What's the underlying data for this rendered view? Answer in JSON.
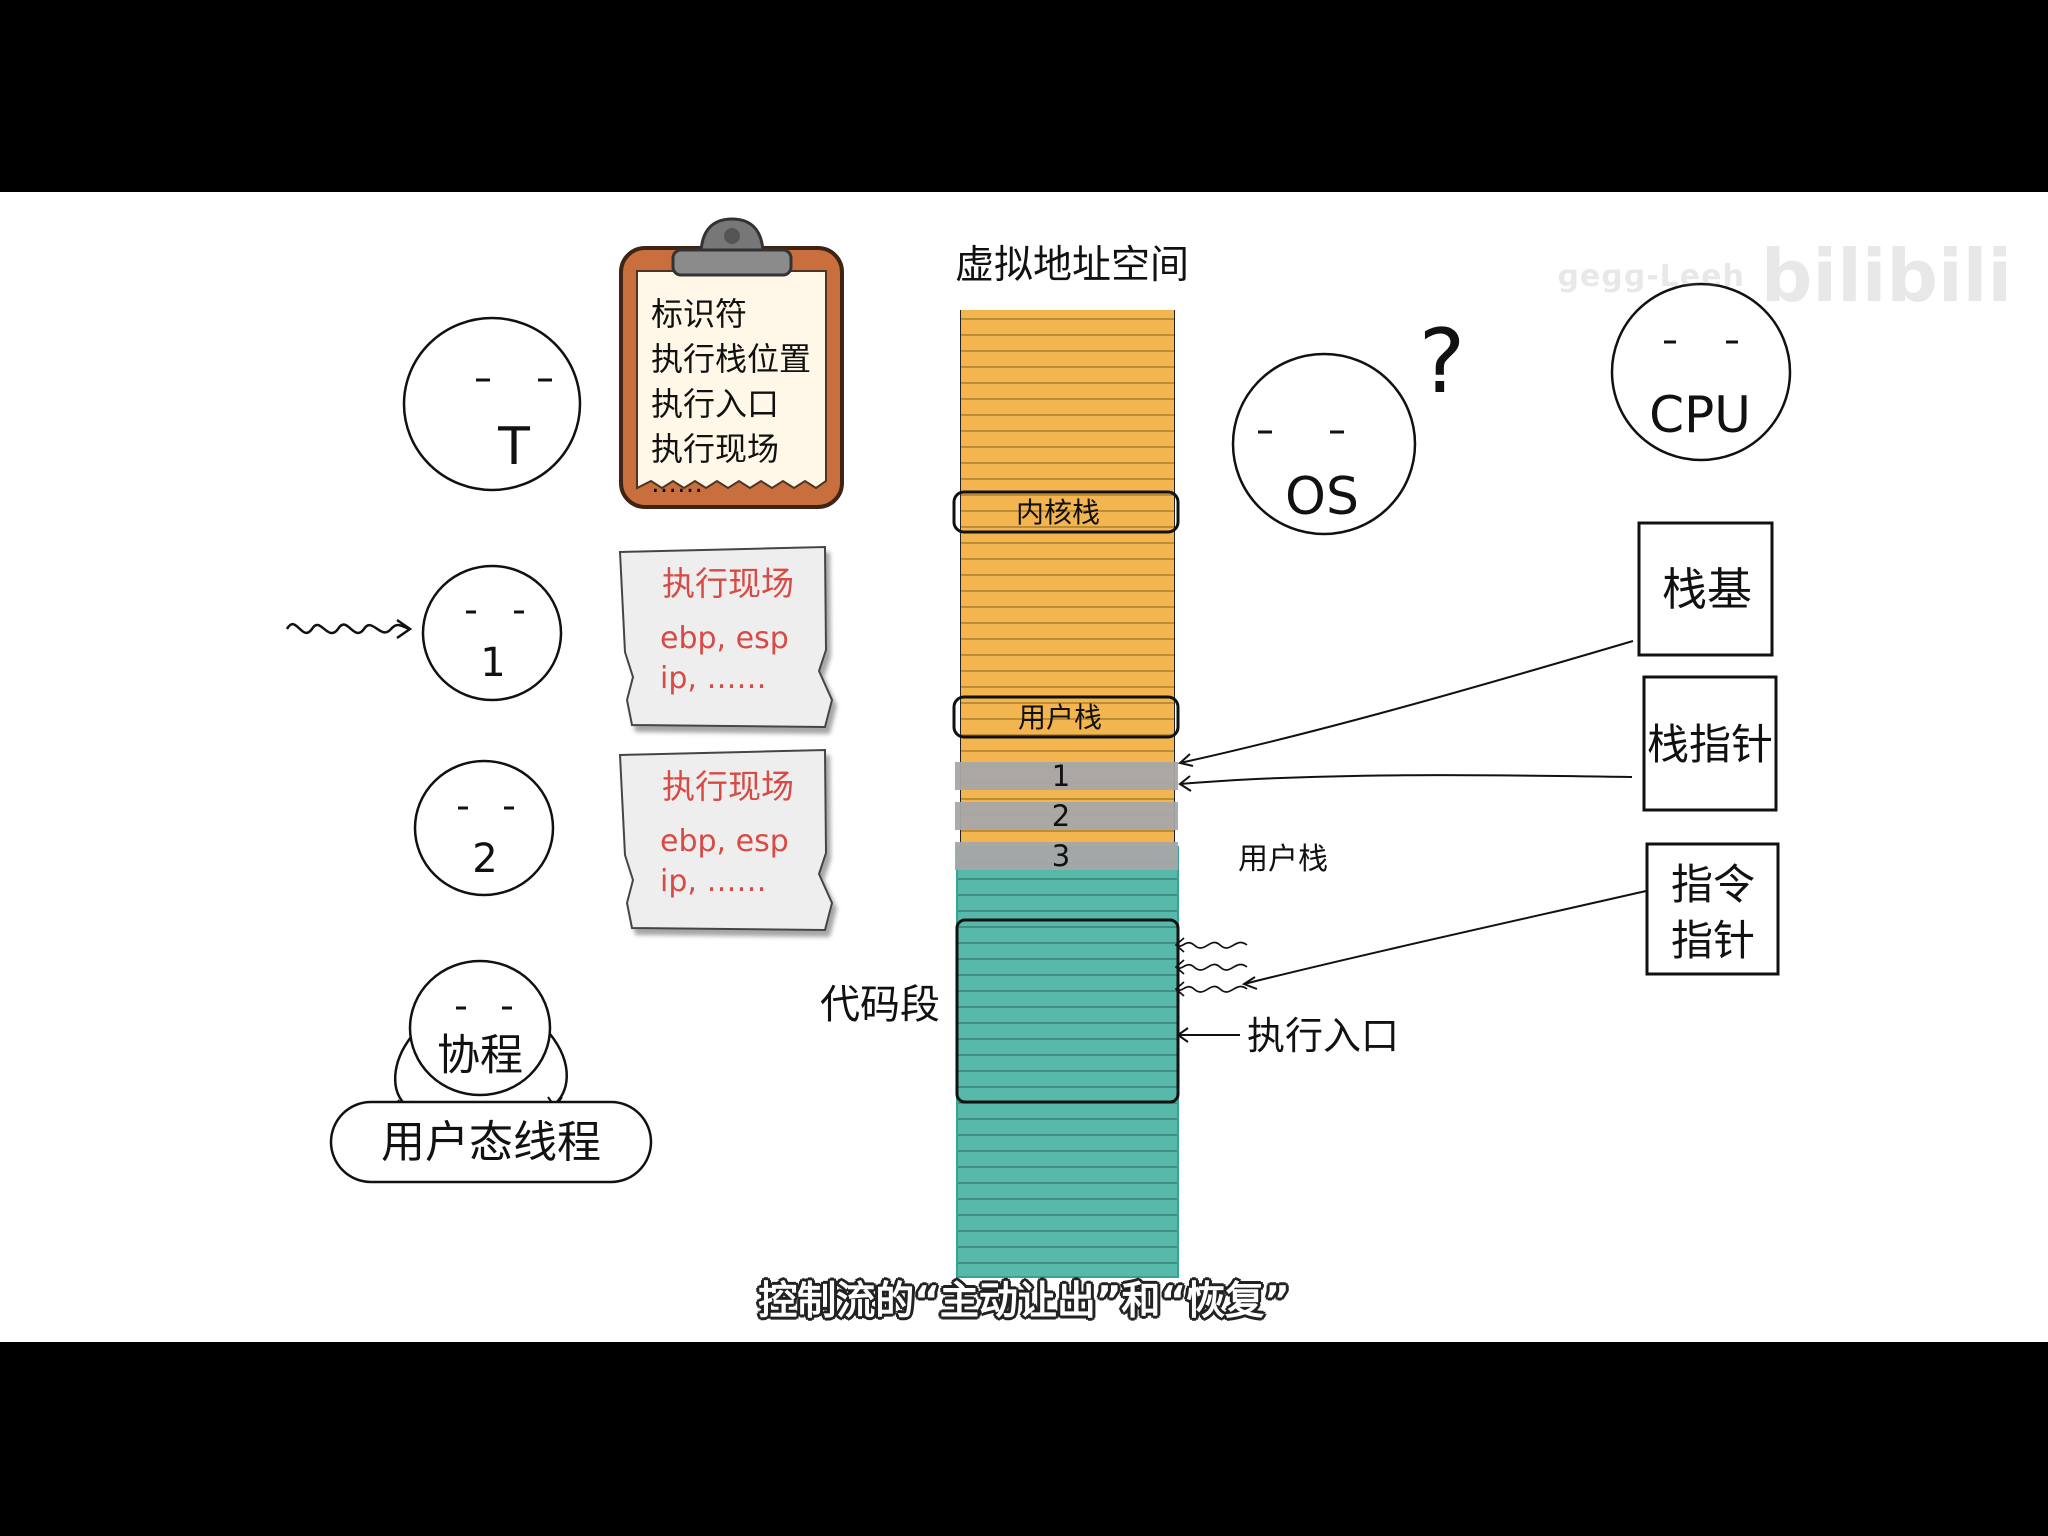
{
  "watermark": {
    "small_text": "ɡeɡɡ-Leeh",
    "logo_text": "bilibili"
  },
  "caption": "控制流的“主动让出”和“恢复”",
  "faces": {
    "thread_t": "T",
    "coroutine_1": "1",
    "coroutine_2": "2",
    "coroutine_main": "协程",
    "os": "OS",
    "os_question": "?",
    "cpu": "CPU",
    "user_thread_label": "用户态线程"
  },
  "clipboard": {
    "items": [
      "标识符",
      "执行栈位置",
      "执行入口",
      "执行现场",
      "……"
    ]
  },
  "context_cards": [
    {
      "title": "执行现场",
      "line1": "ebp, esp",
      "line2": "ip, ……"
    },
    {
      "title": "执行现场",
      "line1": "ebp, esp",
      "line2": "ip, ……"
    }
  ],
  "address_space": {
    "title": "虚拟地址空间",
    "kernel_stack": "内核栈",
    "user_stack": "用户栈",
    "frames": [
      "1",
      "2",
      "3"
    ],
    "frames_label": "用户栈",
    "code_segment": "代码段",
    "entry_label": "执行入口"
  },
  "registers": {
    "stack_base": "栈基",
    "stack_pointer": "栈指针",
    "instruction_pointer_line1": "指令",
    "instruction_pointer_line2": "指针"
  },
  "colors": {
    "kernel_region": "#f2b550",
    "user_region": "#56b9aa",
    "stack_frame_gray": "#a6a6a6",
    "card_bg": "#eeeeee",
    "card_text": "#d84b45",
    "clipboard_board": "#c86f3d",
    "clipboard_paper": "#fff8e8"
  }
}
